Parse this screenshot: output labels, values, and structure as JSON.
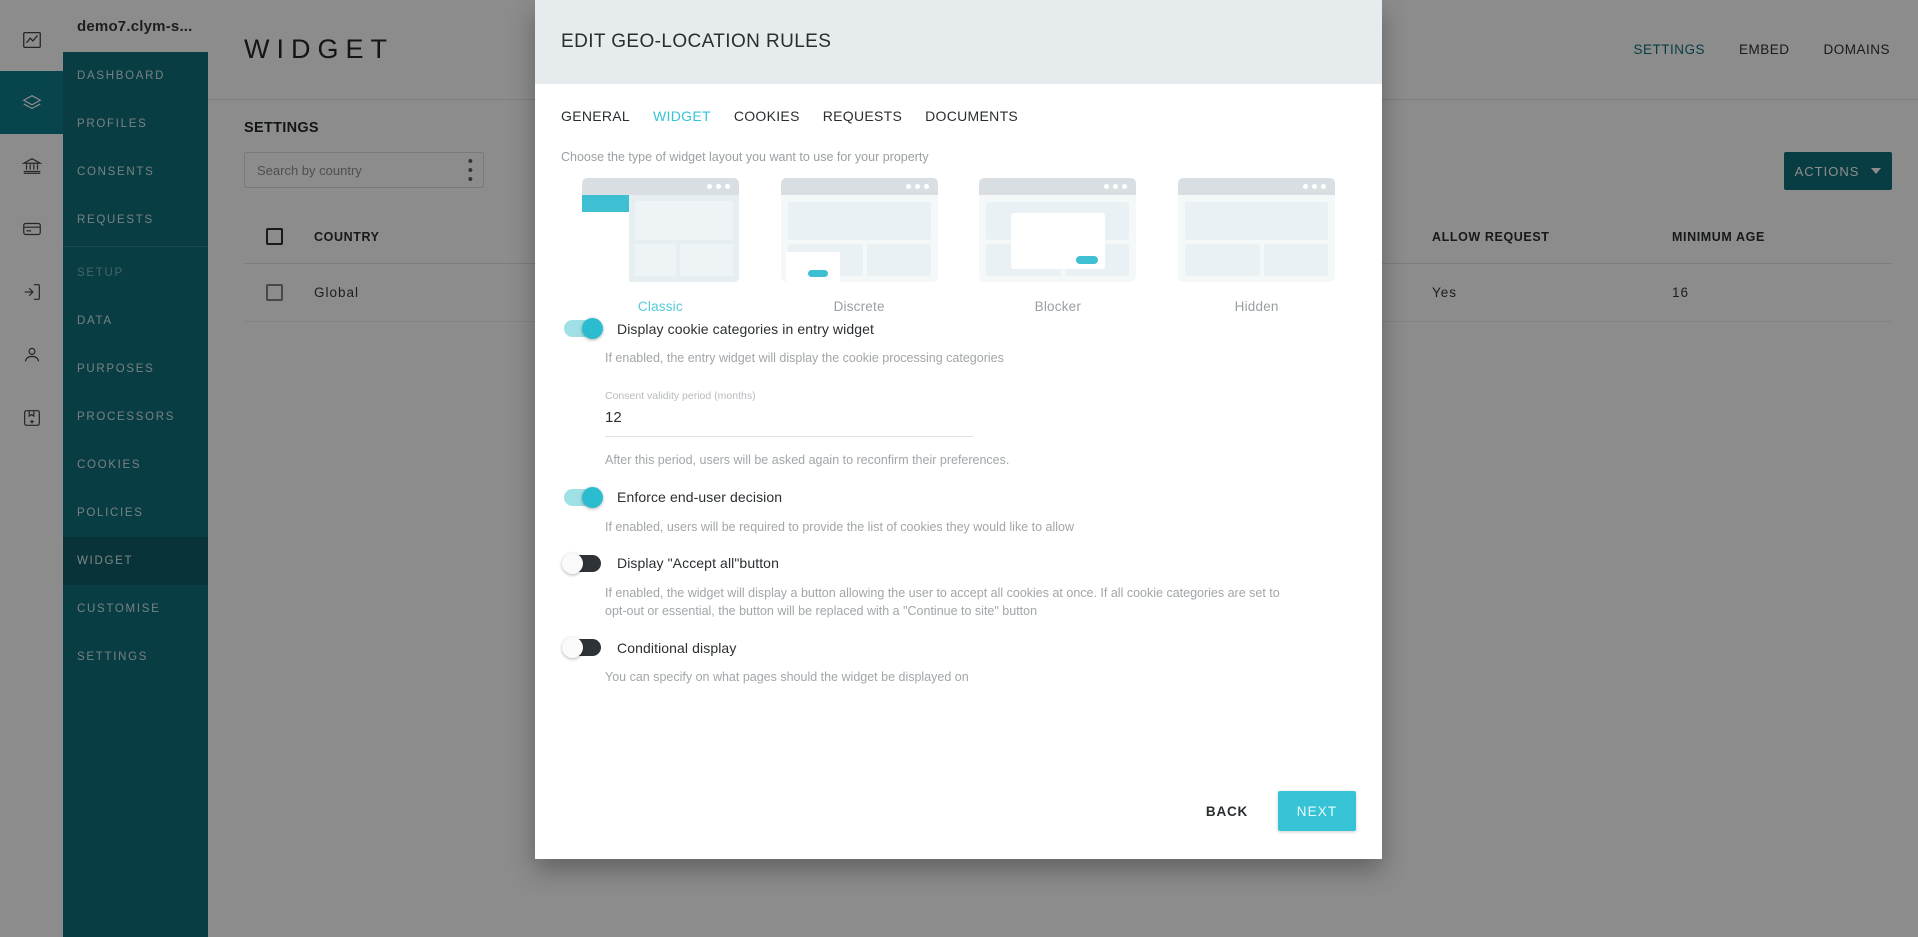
{
  "icon_rail": [
    {
      "name": "analytics-icon"
    },
    {
      "name": "layers-icon",
      "active": true
    },
    {
      "name": "bank-icon"
    },
    {
      "name": "card-icon"
    },
    {
      "name": "login-icon"
    },
    {
      "name": "user-icon"
    },
    {
      "name": "archive-icon"
    }
  ],
  "sidebar": {
    "brand": "demo7.clym-s...",
    "items": [
      {
        "label": "DASHBOARD",
        "state": "normal"
      },
      {
        "label": "PROFILES",
        "state": "normal"
      },
      {
        "label": "CONSENTS",
        "state": "normal"
      },
      {
        "label": "REQUESTS",
        "state": "normal"
      },
      {
        "label": "SETUP",
        "state": "muted"
      },
      {
        "label": "DATA",
        "state": "normal"
      },
      {
        "label": "PURPOSES",
        "state": "normal"
      },
      {
        "label": "PROCESSORS",
        "state": "normal"
      },
      {
        "label": "COOKIES",
        "state": "normal"
      },
      {
        "label": "POLICIES",
        "state": "normal"
      },
      {
        "label": "WIDGET",
        "state": "active"
      },
      {
        "label": "CUSTOMISE",
        "state": "normal"
      },
      {
        "label": "SETTINGS",
        "state": "normal"
      }
    ]
  },
  "page": {
    "title": "WIDGET",
    "tabs": [
      {
        "label": "SETTINGS",
        "active": true
      },
      {
        "label": "EMBED",
        "active": false
      },
      {
        "label": "DOMAINS",
        "active": false
      }
    ],
    "section_label": "SETTINGS",
    "search_placeholder": "Search by country",
    "search_value": "",
    "actions_label": "ACTIONS",
    "table": {
      "columns": [
        "COUNTRY",
        "ALLOW REQUEST",
        "MINIMUM AGE"
      ],
      "rows": [
        {
          "country": "Global",
          "allow_request": "Yes",
          "minimum_age": "16"
        }
      ]
    }
  },
  "modal": {
    "title": "EDIT GEO-LOCATION RULES",
    "tabs": [
      {
        "label": "GENERAL",
        "active": false
      },
      {
        "label": "WIDGET",
        "active": true
      },
      {
        "label": "COOKIES",
        "active": false
      },
      {
        "label": "REQUESTS",
        "active": false
      },
      {
        "label": "DOCUMENTS",
        "active": false
      }
    ],
    "layout_hint": "Choose the type of widget layout you want to use for your property",
    "layouts": [
      {
        "label": "Classic",
        "selected": true
      },
      {
        "label": "Discrete",
        "selected": false
      },
      {
        "label": "Blocker",
        "selected": false
      },
      {
        "label": "Hidden",
        "selected": false
      }
    ],
    "settings": [
      {
        "label": "Display cookie categories in entry widget",
        "enabled": true,
        "description": "If enabled, the entry widget will display the cookie processing categories"
      },
      {
        "label": "Enforce end-user decision",
        "enabled": true,
        "description": "If enabled, users will be required to provide the list of cookies they would like to allow"
      },
      {
        "label": "Display \"Accept all\"button",
        "enabled": false,
        "description": "If enabled, the widget will display a button allowing the user to accept all cookies at once. If all cookie categories are set to opt-out or essential, the button will be replaced with a \"Continue to site\" button"
      },
      {
        "label": "Conditional display",
        "enabled": false,
        "description": "You can specify on what pages should the widget be displayed on"
      }
    ],
    "consent_field": {
      "label": "Consent validity period (months)",
      "value": "12",
      "help": "After this period, users will be asked again to reconfirm their preferences."
    },
    "footer": {
      "back_label": "BACK",
      "next_label": "NEXT"
    }
  },
  "colors": {
    "sidebar_teal": "#11707d",
    "accent_cyan": "#36c3d5",
    "modal_header_bg": "#e6ebed"
  }
}
